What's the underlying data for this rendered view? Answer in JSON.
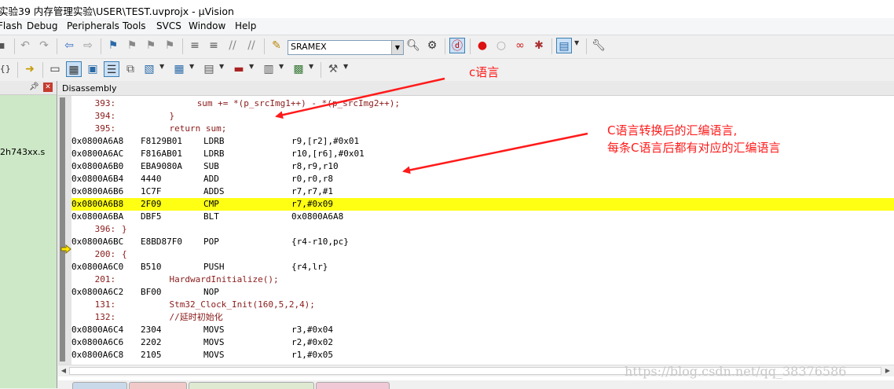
{
  "window": {
    "title": "实验39 内存管理实验\\USER\\TEST.uvprojx - µVision"
  },
  "menu": [
    "Flash",
    "Debug",
    "Peripherals",
    "Tools",
    "SVCS",
    "Window",
    "Help"
  ],
  "toolbar": {
    "target": "SRAMEX"
  },
  "left_pane": {
    "file_label": "2h743xx.s"
  },
  "disassembly": {
    "title": "Disassembly",
    "lines": [
      {
        "kind": "src",
        "num": "393:",
        "text": "sum += *(p_srcImg1++) - *(p_srcImg2++);",
        "indent": 2
      },
      {
        "kind": "src",
        "num": "394:",
        "text": "}",
        "indent": 1
      },
      {
        "kind": "src",
        "num": "395:",
        "text": "return sum;",
        "indent": 1
      },
      {
        "kind": "asm",
        "addr": "0x0800A6A8",
        "code": "F8129B01",
        "op": "LDRB",
        "args": "r9,[r2],#0x01"
      },
      {
        "kind": "asm",
        "addr": "0x0800A6AC",
        "code": "F816AB01",
        "op": "LDRB",
        "args": "r10,[r6],#0x01"
      },
      {
        "kind": "asm",
        "addr": "0x0800A6B0",
        "code": "EBA9080A",
        "op": "SUB",
        "args": "r8,r9,r10"
      },
      {
        "kind": "asm",
        "addr": "0x0800A6B4",
        "code": "4440",
        "op": "ADD",
        "args": "r0,r0,r8"
      },
      {
        "kind": "asm",
        "addr": "0x0800A6B6",
        "code": "1C7F",
        "op": "ADDS",
        "args": "r7,r7,#1"
      },
      {
        "kind": "asm",
        "addr": "0x0800A6B8",
        "code": "2F09",
        "op": "CMP",
        "args": "r7,#0x09",
        "highlight": true
      },
      {
        "kind": "asm",
        "addr": "0x0800A6BA",
        "code": "DBF5",
        "op": "BLT",
        "args": "0x0800A6A8"
      },
      {
        "kind": "src",
        "num": "396:",
        "text": "}",
        "indent": 0
      },
      {
        "kind": "asm",
        "addr": "0x0800A6BC",
        "code": "E8BD87F0",
        "op": "POP",
        "args": "{r4-r10,pc}"
      },
      {
        "kind": "src",
        "num": "200:",
        "text": "{",
        "indent": 0
      },
      {
        "kind": "asm",
        "addr": "0x0800A6C0",
        "code": "B510",
        "op": "PUSH",
        "args": "{r4,lr}",
        "current": true
      },
      {
        "kind": "src",
        "num": "201:",
        "text": "HardwardInitialize();",
        "indent": 1
      },
      {
        "kind": "asm",
        "addr": "0x0800A6C2",
        "code": "BF00",
        "op": "NOP",
        "args": ""
      },
      {
        "kind": "src",
        "num": "131:",
        "text": "Stm32_Clock_Init(160,5,2,4);",
        "indent": 1
      },
      {
        "kind": "src",
        "num": "132:",
        "text": "//延时初始化",
        "indent": 1
      },
      {
        "kind": "asm",
        "addr": "0x0800A6C4",
        "code": "2304",
        "op": "MOVS",
        "args": "r3,#0x04"
      },
      {
        "kind": "asm",
        "addr": "0x0800A6C6",
        "code": "2202",
        "op": "MOVS",
        "args": "r2,#0x02"
      },
      {
        "kind": "asm",
        "addr": "0x0800A6C8",
        "code": "2105",
        "op": "MOVS",
        "args": "r1,#0x05"
      }
    ]
  },
  "annotations": {
    "c_language": "c语言",
    "asm_note_line1": "C语言转换后的汇编语言,",
    "asm_note_line2": "每条C语言后都有对应的汇编语言"
  },
  "watermark": "https://blog.csdn.net/qq_38376586",
  "colors": {
    "highlight": "#ffff14",
    "source_text": "#8b1a1a",
    "annotation": "#ff1a1a",
    "left_pane_bg": "#cde8c6"
  }
}
